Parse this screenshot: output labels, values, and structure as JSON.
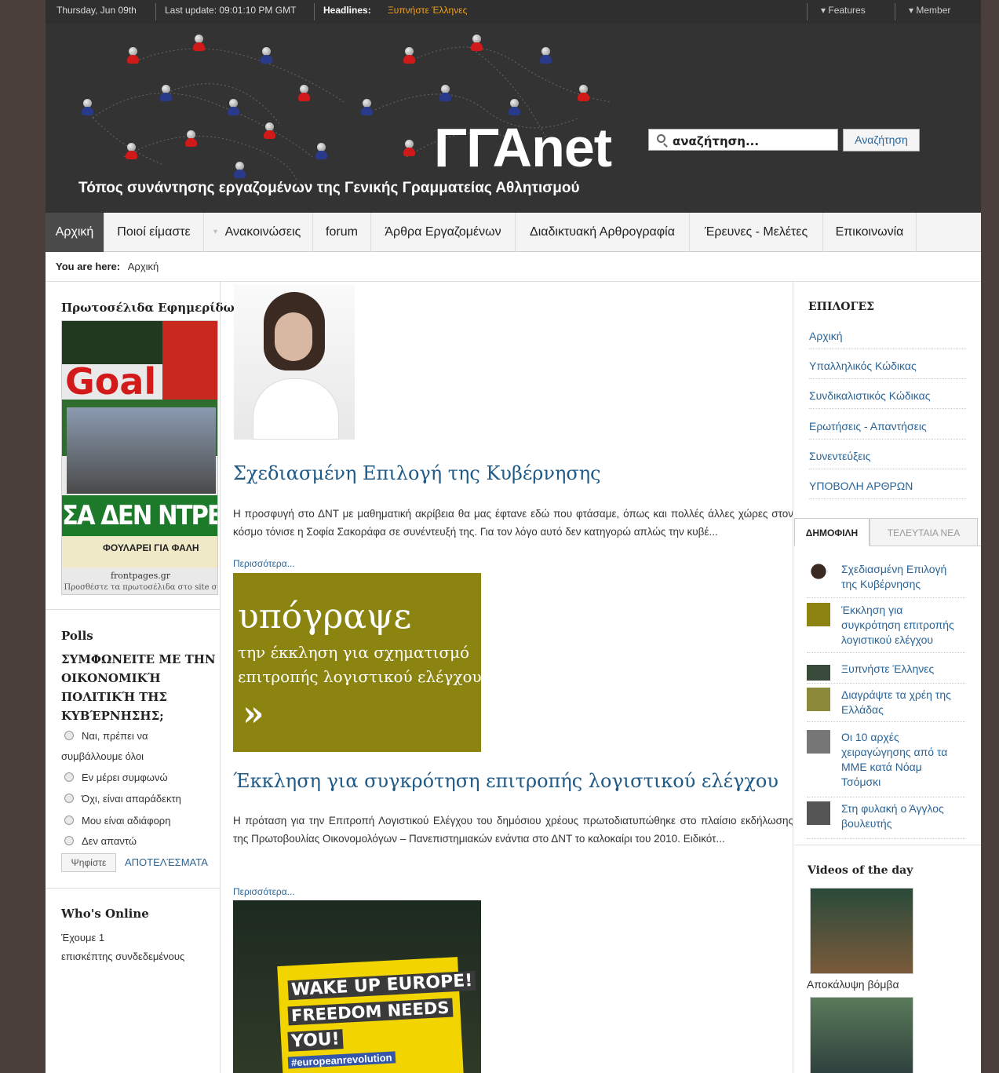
{
  "topbar": {
    "date": "Thursday, Jun 09th",
    "last_update": "Last update: 09:01:10 PM GMT",
    "headlines_label": "Headlines:",
    "headline": "Ξυπνήστε Έλληνες",
    "features": "▾ Features",
    "member": "▾ Member"
  },
  "header": {
    "logo": "ΓΓΑnet",
    "tagline": "Τόπος συνάντησης εργαζομένων της Γενικής Γραμματείας Αθλητισμού",
    "search_placeholder": "αναζήτηση...",
    "search_button": "Αναζήτηση"
  },
  "nav": {
    "items": [
      "Αρχική",
      "Ποιοί είμαστε",
      "Ανακοινώσεις",
      "forum",
      "Άρθρα Εργαζομένων",
      "Διαδικτυακή Αρθρογραφία",
      "Έρευνες - Μελέτες",
      "Επικοινωνία"
    ]
  },
  "breadcrumb": {
    "label": "You are here:",
    "current": "Αρχική"
  },
  "left": {
    "frontpages_title": "Πρωτοσέλιδα Εφημερίδων",
    "newspaper": {
      "brand": "Goal",
      "headline": "ΣΑ ΔΕΝ ΝΤΡΕΠΕΣΤ",
      "sub": "ΦΟΥΛΑΡΕΙ ΓΙΑ ΦΑΛΗ",
      "site": "frontpages.gr",
      "caption": "Προσθέστε τα πρωτοσέλιδα στο site σ"
    },
    "polls_title": "Polls",
    "poll_question": "ΣΥΜΦΩΝΕΙΤΕ ΜΕ ΤΗΝ ΟΙΚΟΝΟΜΙΚΉ ΠΟΛΙΤΙΚΉ ΤΗΣ ΚΥΒΈΡΝΗΣΗΣ;",
    "poll_options": [
      "Ναι, πρέπει να",
      "συμβάλλουμε όλοι",
      "Εν μέρει συμφωνώ",
      "Όχι, είναι απαράδεκτη",
      "Μου είναι αδιάφορη",
      "Δεν απαντώ"
    ],
    "vote_button": "Ψηφίστε",
    "results_link": "ΑΠΟΤΕΛΈΣΜΑΤΑ",
    "online_title": "Who's Online",
    "online_text_1": "Έχουμε 1",
    "online_text_2": "επισκέπτης συνδεδεμένους"
  },
  "articles": [
    {
      "title": "Σχεδιασμένη Επιλογή της Κυβέρνησης",
      "body": "Η προσφυγή στο ΔΝΤ με μαθηματική ακρίβεια θα μας έφτανε εδώ που φτάσαμε, όπως και πολλές άλλες χώρες στον κόσμο τόνισε η Σοφία Σακοράφα σε συνέντευξή της. Για τον λόγο αυτό δεν κατηγορώ απλώς την κυβέ...",
      "more": "Περισσότερα..."
    },
    {
      "title": "Έκκληση για συγκρότηση επιτροπής λογιστικού ελέγχου",
      "body": "Η πρόταση για την Επιτροπή Λογιστικού Ελέγχου του δημόσιου χρέους πρωτοδιατυπώθηκε στο πλαίσιο εκδήλωσης της Πρωτοβουλίας Οικονομολόγων – Πανεπιστημιακών ενάντια στο ΔΝΤ το καλοκαίρι του 2010. Ειδικότ...",
      "more": "Περισσότερα..."
    }
  ],
  "banner": {
    "line1": "υπόγραψε",
    "line2": "την έκκληση για σχηματισμό",
    "line3": "επιτροπής λογιστικού ελέγχου",
    "arrow": "»"
  },
  "sign": {
    "l1": "WAKE UP EUROPE!",
    "l2": "FREEDOM NEEDS",
    "l3": "YOU!",
    "l4": "#europeanrevolution"
  },
  "right": {
    "options_title": "ΕΠΙΛΟΓΕΣ",
    "options": [
      "Αρχική",
      "Υπαλληλικός Κώδικας",
      "Συνδικαλιστικός Κώδικας",
      "Ερωτήσεις - Απαντήσεις",
      "Συνεντεύξεις",
      "ΥΠΟΒΟΛΗ ΑΡΘΡΩΝ"
    ],
    "tab_popular": "ΔΗΜΟΦΙΛΗ",
    "tab_latest": "ΤΕΛΕΥΤΑΙΑ ΝΕΑ",
    "popular": [
      "Σχεδιασμένη Επιλογή της Κυβέρνησης",
      "Έκκληση για συγκρότηση επιτροπής λογιστικού ελέγχου",
      "Ξυπνήστε Έλληνες",
      "Διαγράψτε τα χρέη της Ελλάδας",
      "Οι 10 αρχές χειραγώγησης από τα ΜΜΕ κατά Νόαμ Τσόμσκι",
      "Στη φυλακή ο Άγγλος βουλευτής"
    ],
    "videos_title": "Videos of the day",
    "video_caption": "Αποκάλυψη βόμβα"
  },
  "colors": {
    "accent": "#2a6496",
    "header_bg": "#333333",
    "nav_active": "#4b4b4b",
    "banner": "#8b8411"
  }
}
